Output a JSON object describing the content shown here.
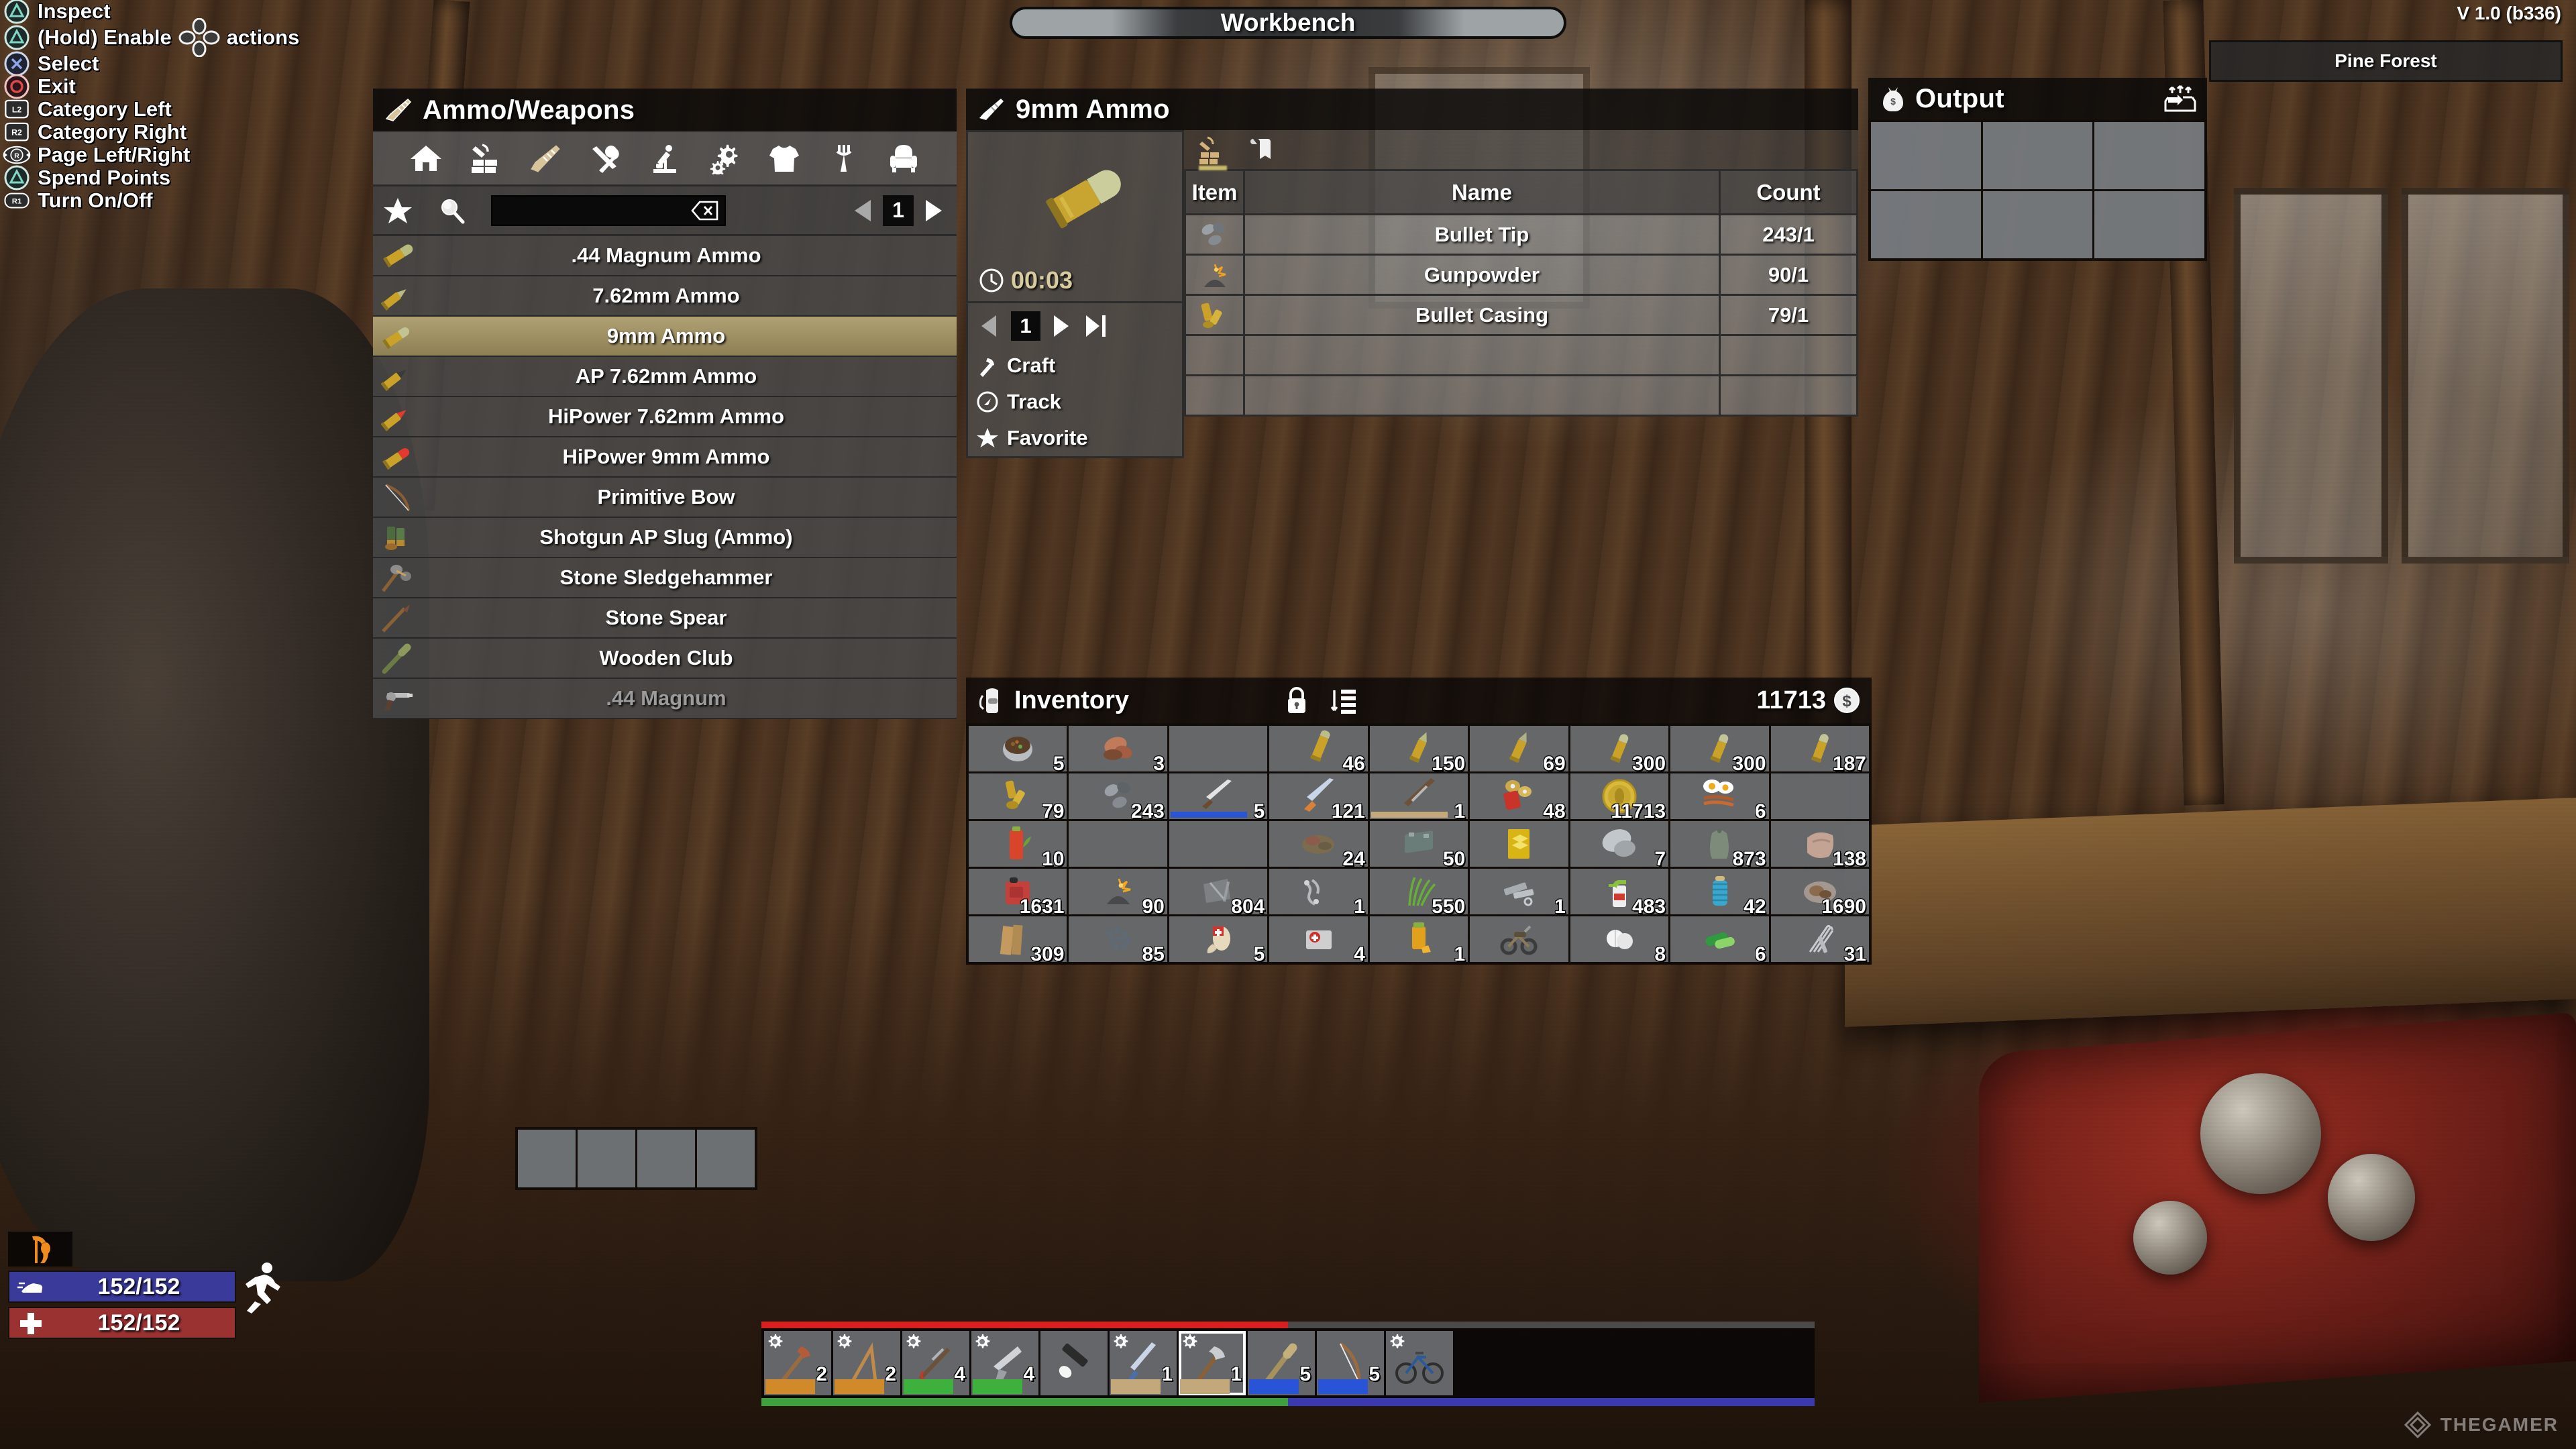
{
  "window": {
    "title": "Workbench",
    "version": "V 1.0 (b336)",
    "biome": "Pine Forest"
  },
  "legend": {
    "items": [
      {
        "button": "triangle",
        "label": "Inspect"
      },
      {
        "button": "triangle",
        "label": "(Hold) Enable",
        "label2": "actions",
        "dpad": true
      },
      {
        "button": "cross",
        "label": "Select"
      },
      {
        "button": "circle",
        "label": "Exit"
      },
      {
        "button": "L2",
        "label": "Category Left"
      },
      {
        "button": "R2",
        "label": "Category Right"
      },
      {
        "button": "RSTICK",
        "label": "Page Left/Right"
      },
      {
        "button": "triangle",
        "label": "Spend Points"
      },
      {
        "button": "R1",
        "label": "Turn On/Off"
      }
    ]
  },
  "craft_panel": {
    "title": "Ammo/Weapons",
    "title_icon": "knife-icon",
    "category_tabs": [
      {
        "icon": "home-icon",
        "name": "basics",
        "active": false
      },
      {
        "icon": "hammer-blocks-icon",
        "name": "building",
        "active": false
      },
      {
        "icon": "knife-icon",
        "name": "ammo-weapons",
        "active": true
      },
      {
        "icon": "tools-icon",
        "name": "tools",
        "active": false
      },
      {
        "icon": "microscope-icon",
        "name": "chemicals",
        "active": false
      },
      {
        "icon": "gears-icon",
        "name": "resources",
        "active": false
      },
      {
        "icon": "shirt-icon",
        "name": "clothing",
        "active": false
      },
      {
        "icon": "fork-icon",
        "name": "food",
        "active": false
      },
      {
        "icon": "chair-icon",
        "name": "decor",
        "active": false
      }
    ],
    "search": {
      "value": "",
      "placeholder": ""
    },
    "page": "1",
    "recipes": [
      {
        "name": ".44 Magnum Ammo",
        "icon": "bullet-44",
        "selected": false,
        "locked": false
      },
      {
        "name": "7.62mm Ammo",
        "icon": "bullet-762",
        "selected": false,
        "locked": false
      },
      {
        "name": "9mm Ammo",
        "icon": "bullet-9mm",
        "selected": true,
        "locked": false
      },
      {
        "name": "AP 7.62mm Ammo",
        "icon": "bullet-ap762",
        "selected": false,
        "locked": false
      },
      {
        "name": "HiPower 7.62mm Ammo",
        "icon": "bullet-hp762",
        "selected": false,
        "locked": false
      },
      {
        "name": "HiPower 9mm Ammo",
        "icon": "bullet-hp9",
        "selected": false,
        "locked": false
      },
      {
        "name": "Primitive Bow",
        "icon": "bow-icon",
        "selected": false,
        "locked": false
      },
      {
        "name": "Shotgun AP Slug (Ammo)",
        "icon": "shell-icon",
        "selected": false,
        "locked": false
      },
      {
        "name": "Stone Sledgehammer",
        "icon": "sledge-icon",
        "selected": false,
        "locked": false
      },
      {
        "name": "Stone Spear",
        "icon": "spear-icon",
        "selected": false,
        "locked": false
      },
      {
        "name": "Wooden Club",
        "icon": "club-icon",
        "selected": false,
        "locked": false
      },
      {
        "name": ".44 Magnum",
        "icon": "revolver-icon",
        "selected": false,
        "locked": true
      }
    ],
    "empty_slots": 4
  },
  "recipe_panel": {
    "title": "9mm Ammo",
    "title_icon": "knife-icon",
    "craft_time": "00:03",
    "craft_count": "1",
    "actions": [
      {
        "label": "Craft",
        "icon": "hammer-icon"
      },
      {
        "label": "Track",
        "icon": "compass-icon"
      },
      {
        "label": "Favorite",
        "icon": "star-icon"
      }
    ],
    "tabs": [
      {
        "icon": "ingredients-icon",
        "name": "ingredients",
        "active": true
      },
      {
        "icon": "book-icon",
        "name": "description",
        "active": false
      }
    ],
    "table": {
      "headers": [
        "Item",
        "Name",
        "Count"
      ],
      "rows": [
        {
          "icon": "bullet-tip-icon",
          "name": "Bullet Tip",
          "count": "243/1"
        },
        {
          "icon": "gunpowder-icon",
          "name": "Gunpowder",
          "count": "90/1"
        },
        {
          "icon": "bullet-casing-icon",
          "name": "Bullet Casing",
          "count": "79/1"
        },
        {
          "icon": "",
          "name": "",
          "count": ""
        },
        {
          "icon": "",
          "name": "",
          "count": ""
        }
      ]
    }
  },
  "output_panel": {
    "title": "Output",
    "title_icon": "money-bag-icon",
    "action_icon": "take-all-icon",
    "slots": 6
  },
  "inventory": {
    "title": "Inventory",
    "title_icon": "backpack-icon",
    "lock_icon": "lock-icon",
    "sort_icon": "sort-icon",
    "money": "11713",
    "money_icon": "dollar-icon",
    "slots": [
      {
        "icon": "stew-pot",
        "qty": "5"
      },
      {
        "icon": "raw-meat",
        "qty": "3"
      },
      {
        "icon": "",
        "qty": ""
      },
      {
        "icon": "bullet-44",
        "qty": "46"
      },
      {
        "icon": "bullet-762",
        "qty": "150"
      },
      {
        "icon": "bullet-ap762",
        "qty": "69"
      },
      {
        "icon": "bullet-9mm",
        "qty": "300"
      },
      {
        "icon": "bullet-9mm",
        "qty": "300"
      },
      {
        "icon": "bullet-9mm",
        "qty": "187"
      },
      {
        "icon": "bullet-casing",
        "qty": "79"
      },
      {
        "icon": "bullet-tip",
        "qty": "243"
      },
      {
        "icon": "hunting-knife",
        "qty": "5",
        "durability": "#2a54d8"
      },
      {
        "icon": "machete",
        "qty": "121"
      },
      {
        "icon": "lever-rifle",
        "qty": "1",
        "durability": "#c3a87b"
      },
      {
        "icon": "shotgun-shells",
        "qty": "48"
      },
      {
        "icon": "casino-coin",
        "qty": "11713"
      },
      {
        "icon": "bacon-eggs",
        "qty": "6"
      },
      {
        "icon": "",
        "qty": ""
      },
      {
        "icon": "tomato-juice",
        "qty": "10"
      },
      {
        "icon": "",
        "qty": ""
      },
      {
        "icon": "",
        "qty": ""
      },
      {
        "icon": "rotting-flesh",
        "qty": "24"
      },
      {
        "icon": "car-battery",
        "qty": "50"
      },
      {
        "icon": "yellow-book",
        "qty": ""
      },
      {
        "icon": "hub-cap",
        "qty": "7"
      },
      {
        "icon": "cloth-bag",
        "qty": "873"
      },
      {
        "icon": "cloth-fragment",
        "qty": "138"
      },
      {
        "icon": "gas-can",
        "qty": "1631"
      },
      {
        "icon": "gunpowder",
        "qty": "90"
      },
      {
        "icon": "iron-scrap",
        "qty": "804"
      },
      {
        "icon": "chain-parts",
        "qty": "1"
      },
      {
        "icon": "grass-fiber",
        "qty": "550"
      },
      {
        "icon": "mech-parts",
        "qty": "1"
      },
      {
        "icon": "cleaner-spray",
        "qty": "483"
      },
      {
        "icon": "yarn-spool",
        "qty": "42"
      },
      {
        "icon": "raw-mineral",
        "qty": "1690"
      },
      {
        "icon": "wood-planks",
        "qty": "309"
      },
      {
        "icon": "iron-pellets",
        "qty": "85"
      },
      {
        "icon": "bandage",
        "qty": "5"
      },
      {
        "icon": "first-aid",
        "qty": "4"
      },
      {
        "icon": "honey-jar",
        "qty": "1"
      },
      {
        "icon": "minibike",
        "qty": ""
      },
      {
        "icon": "pills",
        "qty": "8"
      },
      {
        "icon": "capsules",
        "qty": "6"
      },
      {
        "icon": "lockpicks",
        "qty": "31"
      }
    ]
  },
  "hotbar": {
    "slots": [
      {
        "icon": "stone-axe",
        "qty": "2",
        "mod": true,
        "durability": "#d08a2a",
        "active": false
      },
      {
        "icon": "wood-bow",
        "qty": "2",
        "mod": true,
        "durability": "#d08a2a",
        "active": false
      },
      {
        "icon": "crossbow",
        "qty": "4",
        "mod": true,
        "durability": "#3eb03e",
        "active": false
      },
      {
        "icon": "pistol",
        "qty": "4",
        "mod": true,
        "durability": "#3eb03e",
        "active": false
      },
      {
        "icon": "flashlight",
        "qty": "",
        "mod": false,
        "durability": "",
        "active": false
      },
      {
        "icon": "machete",
        "qty": "1",
        "mod": true,
        "durability": "#c3a87b",
        "active": false
      },
      {
        "icon": "stone-axe-2",
        "qty": "1",
        "mod": true,
        "durability": "#c3a87b",
        "active": true
      },
      {
        "icon": "club",
        "qty": "5",
        "mod": false,
        "durability": "#2a54d8",
        "active": false
      },
      {
        "icon": "bow",
        "qty": "5",
        "mod": false,
        "durability": "#2a54d8",
        "active": false
      },
      {
        "icon": "bicycle",
        "qty": "",
        "mod": true,
        "durability": "",
        "active": false
      }
    ]
  },
  "status": {
    "buff_icon": "grim-reaper-icon",
    "stamina": {
      "value": "152/152",
      "icon": "boot-icon",
      "color": "#3a3a9a"
    },
    "health": {
      "value": "152/152",
      "icon": "cross-icon",
      "color": "#9a3232"
    },
    "run_icon": "running-icon"
  },
  "watermark": {
    "text": "THEGAMER",
    "icon": "thegamer-logo"
  }
}
